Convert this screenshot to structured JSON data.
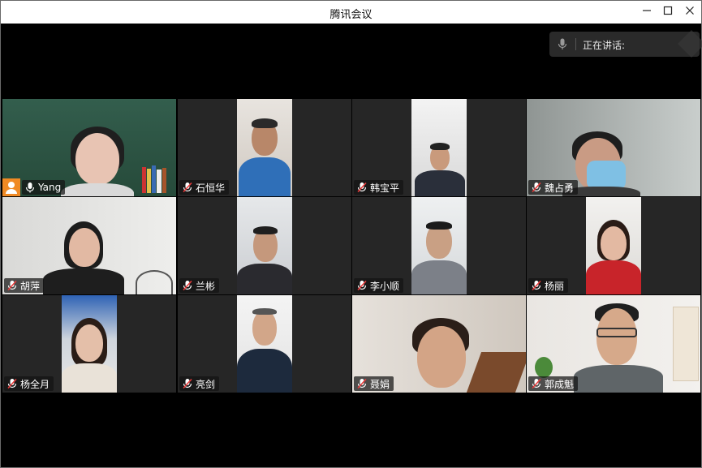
{
  "window": {
    "title": "腾讯会议",
    "controls": [
      "minimize",
      "maximize",
      "close"
    ]
  },
  "speaking_panel": {
    "label": "正在讲话:",
    "icon": "microphone-icon"
  },
  "participants": [
    {
      "name": "Yang",
      "mic": "on",
      "host": true
    },
    {
      "name": "石恒华",
      "mic": "muted"
    },
    {
      "name": "韩宝平",
      "mic": "muted"
    },
    {
      "name": "魏占勇",
      "mic": "muted"
    },
    {
      "name": "胡萍",
      "mic": "muted"
    },
    {
      "name": "兰彬",
      "mic": "muted"
    },
    {
      "name": "李小顺",
      "mic": "muted"
    },
    {
      "name": "杨丽",
      "mic": "muted"
    },
    {
      "name": "杨全月",
      "mic": "muted"
    },
    {
      "name": "亮剑",
      "mic": "muted"
    },
    {
      "name": "聂娟",
      "mic": "muted"
    },
    {
      "name": "郭成魁",
      "mic": "muted"
    }
  ],
  "colors": {
    "tile_bg": "#262626",
    "host_badge": "#f08a24",
    "active_border": "#c8a56a"
  }
}
